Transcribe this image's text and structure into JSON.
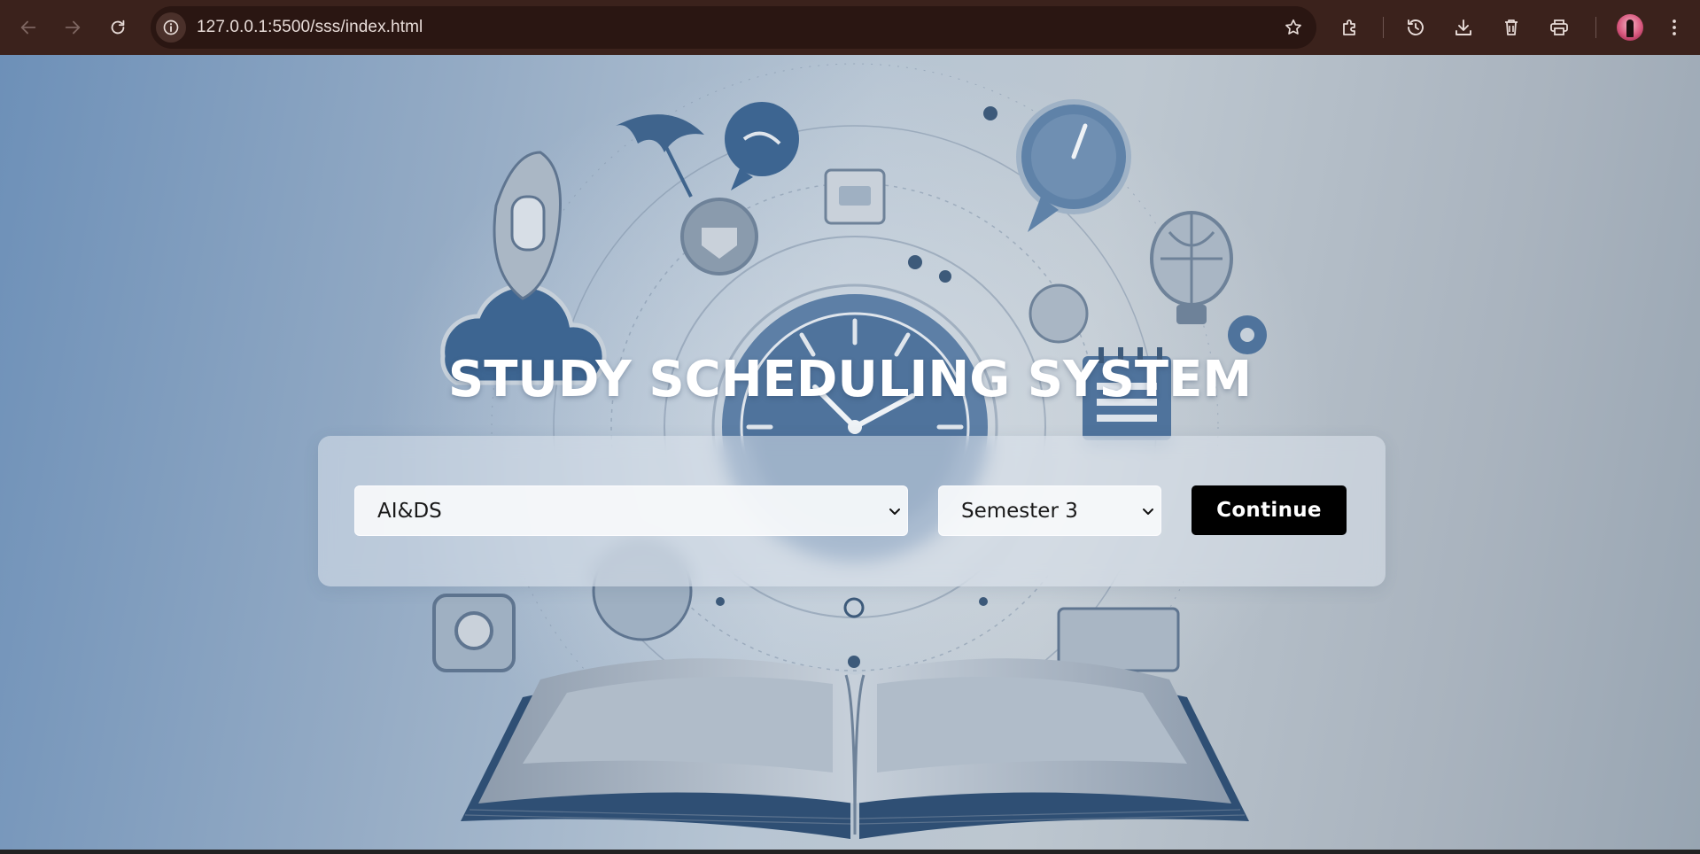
{
  "browser": {
    "url": "127.0.0.1:5500/sss/index.html",
    "icons": [
      "back-arrow-icon",
      "forward-arrow-icon",
      "reload-icon",
      "site-info-icon",
      "bookmark-star-icon",
      "extensions-icon",
      "history-icon",
      "download-icon",
      "delete-icon",
      "print-icon",
      "profile-avatar",
      "more-menu-icon"
    ]
  },
  "page": {
    "title": "STUDY SCHEDULING SYSTEM",
    "department_select": {
      "value": "AI&DS"
    },
    "semester_select": {
      "value": "Semester 3"
    },
    "continue_label": "Continue"
  },
  "colors": {
    "toolbar": "#3b221c",
    "button": "#000000",
    "title": "#ffffff"
  }
}
